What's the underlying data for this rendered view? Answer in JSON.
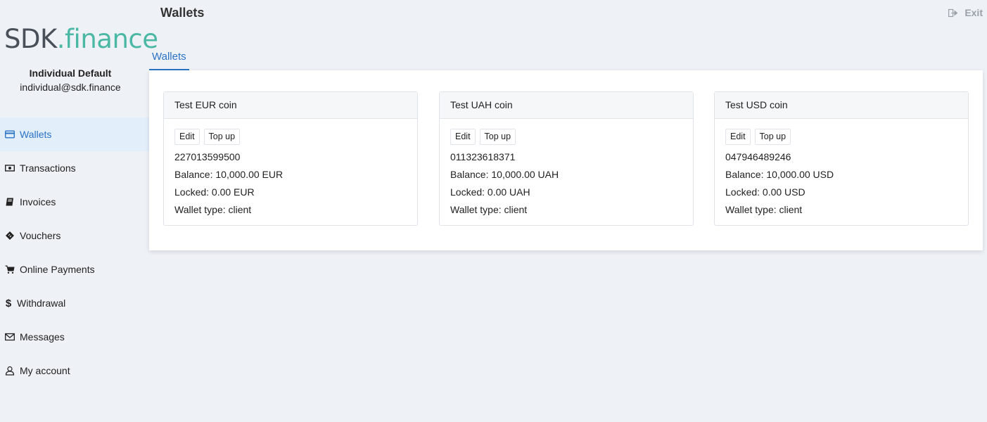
{
  "logo": {
    "part1": "SDK",
    "part2": ".finance"
  },
  "user": {
    "name": "Individual Default",
    "email": "individual@sdk.finance"
  },
  "nav": [
    {
      "label": "Wallets",
      "icon": "credit-card-icon",
      "active": true
    },
    {
      "label": "Transactions",
      "icon": "money-icon",
      "active": false
    },
    {
      "label": "Invoices",
      "icon": "book-icon",
      "active": false
    },
    {
      "label": "Vouchers",
      "icon": "ticket-icon",
      "active": false
    },
    {
      "label": "Online Payments",
      "icon": "cart-icon",
      "active": false
    },
    {
      "label": "Withdrawal",
      "icon": "dollar-icon",
      "active": false
    },
    {
      "label": "Messages",
      "icon": "envelope-icon",
      "active": false
    },
    {
      "label": "My account",
      "icon": "user-icon",
      "active": false
    }
  ],
  "header": {
    "title": "Wallets",
    "exit_label": "Exit"
  },
  "tabs": [
    {
      "label": "Wallets",
      "active": true
    }
  ],
  "wallets": [
    {
      "name": "Test EUR coin",
      "edit_label": "Edit",
      "topup_label": "Top up",
      "number": "227013599500",
      "balance": "Balance: 10,000.00 EUR",
      "locked": "Locked: 0.00 EUR",
      "type": "Wallet type: client"
    },
    {
      "name": "Test UAH coin",
      "edit_label": "Edit",
      "topup_label": "Top up",
      "number": "011323618371",
      "balance": "Balance: 10,000.00 UAH",
      "locked": "Locked: 0.00 UAH",
      "type": "Wallet type: client"
    },
    {
      "name": "Test USD coin",
      "edit_label": "Edit",
      "topup_label": "Top up",
      "number": "047946489246",
      "balance": "Balance: 10,000.00 USD",
      "locked": "Locked: 0.00 USD",
      "type": "Wallet type: client"
    }
  ],
  "colors": {
    "accent": "#2a73c5",
    "brand": "#4bb8a6",
    "active_bg": "#e2eefa",
    "page_bg": "#eef1f6"
  }
}
